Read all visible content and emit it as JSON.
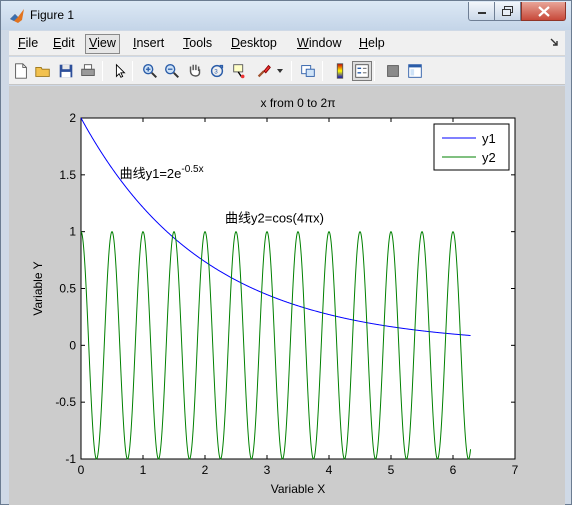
{
  "window": {
    "title": "Figure 1"
  },
  "menu": [
    {
      "label": "File",
      "mnemonic": "F",
      "rest": "ile",
      "name": "menu-file"
    },
    {
      "label": "Edit",
      "mnemonic": "E",
      "rest": "dit",
      "name": "menu-edit"
    },
    {
      "label": "View",
      "mnemonic": "V",
      "rest": "iew",
      "name": "menu-view",
      "active": true
    },
    {
      "label": "Insert",
      "mnemonic": "I",
      "rest": "nsert",
      "name": "menu-insert"
    },
    {
      "label": "Tools",
      "mnemonic": "T",
      "rest": "ools",
      "name": "menu-tools"
    },
    {
      "label": "Desktop",
      "mnemonic": "D",
      "rest": "esktop",
      "name": "menu-desktop"
    },
    {
      "label": "Window",
      "mnemonic": "W",
      "rest": "indow",
      "name": "menu-window"
    },
    {
      "label": "Help",
      "mnemonic": "H",
      "rest": "elp",
      "name": "menu-help"
    }
  ],
  "toolbar": [
    {
      "icon": "new-figure-icon"
    },
    {
      "icon": "open-file-icon"
    },
    {
      "icon": "save-figure-icon"
    },
    {
      "icon": "print-figure-icon"
    },
    {
      "icon": "edit-plot-arrow-icon"
    },
    {
      "icon": "zoom-in-icon"
    },
    {
      "icon": "zoom-out-icon"
    },
    {
      "icon": "pan-hand-icon"
    },
    {
      "icon": "rotate-3d-icon"
    },
    {
      "icon": "data-cursor-icon"
    },
    {
      "icon": "brush-icon"
    },
    {
      "icon": "link-plot-icon"
    },
    {
      "icon": "colorbar-icon"
    },
    {
      "icon": "legend-icon"
    },
    {
      "icon": "hide-plot-tools-icon"
    },
    {
      "icon": "show-plot-tools-icon"
    }
  ],
  "chart_data": {
    "type": "line",
    "title": "x from 0 to 2π",
    "xlabel": "Variable X",
    "ylabel": "Variable Y",
    "xlim": [
      0,
      7
    ],
    "ylim": [
      -1,
      2
    ],
    "xticks": [
      "0",
      "1",
      "2",
      "3",
      "4",
      "5",
      "6",
      "7"
    ],
    "yticks": [
      "-1",
      "-0.5",
      "0",
      "0.5",
      "1",
      "1.5",
      "2"
    ],
    "x_range": [
      0,
      6.2832
    ],
    "series": [
      {
        "name": "y1",
        "color": "#0000ff",
        "formula": "2*exp(-0.5*x)",
        "x": [
          0,
          0.5,
          1,
          1.5,
          2,
          2.5,
          3,
          3.5,
          4,
          4.5,
          5,
          5.5,
          6,
          6.2832
        ],
        "y": [
          2,
          1.558,
          1.213,
          0.945,
          0.736,
          0.573,
          0.446,
          0.348,
          0.271,
          0.211,
          0.164,
          0.128,
          0.1,
          0.086
        ]
      },
      {
        "name": "y2",
        "color": "#008000",
        "formula": "cos(4*pi*x)",
        "x": [
          0,
          0.25,
          0.5,
          0.75,
          1,
          1.25,
          1.5,
          1.75,
          2,
          2.25,
          2.5,
          2.75,
          3,
          3.25,
          3.5,
          3.75,
          4,
          4.25,
          4.5,
          4.75,
          5,
          5.25,
          5.5,
          5.75,
          6,
          6.25,
          6.2832
        ],
        "y": [
          1,
          -1,
          1,
          -1,
          1,
          -1,
          1,
          -1,
          1,
          -1,
          1,
          -1,
          1,
          -1,
          1,
          -1,
          1,
          -1,
          1,
          -1,
          1,
          -1,
          1,
          -1,
          1,
          -1,
          -0.93
        ]
      }
    ],
    "legend": {
      "position": "top-right",
      "entries": [
        "y1",
        "y2"
      ]
    },
    "annotations": [
      {
        "prefix": "曲线y1=2e",
        "superscript": "-0.5x",
        "x": 0.8,
        "y": 1.47
      },
      {
        "prefix": "曲线y2=cos(4πx)",
        "superscript": "",
        "x": 2.5,
        "y": 1.08
      }
    ],
    "grid": false
  }
}
